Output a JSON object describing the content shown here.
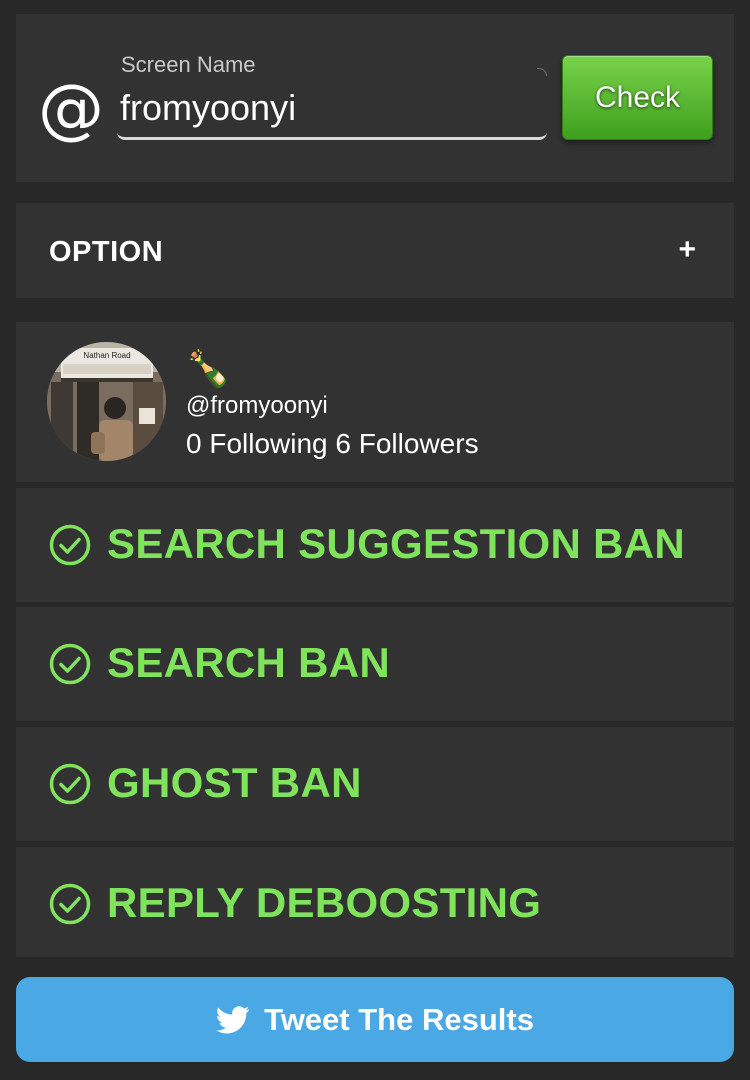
{
  "search": {
    "at_symbol": "@",
    "label": "Screen Name",
    "value": "fromyoonyi",
    "check_label": "Check"
  },
  "option": {
    "label": "OPTION",
    "toggle": "+"
  },
  "profile": {
    "emoji": "🍾",
    "handle": "@fromyoonyi",
    "follow_text": "0 Following 6 Followers",
    "avatar_sign_text": "Nathan Road"
  },
  "results": [
    {
      "label": "SEARCH SUGGESTION BAN",
      "status": "ok"
    },
    {
      "label": "SEARCH BAN",
      "status": "ok"
    },
    {
      "label": "GHOST BAN",
      "status": "ok"
    },
    {
      "label": "REPLY DEBOOSTING",
      "status": "ok"
    }
  ],
  "tweet": {
    "label": "Tweet The Results",
    "icon": "twitter-bird-icon"
  },
  "colors": {
    "background": "#282828",
    "card": "#323232",
    "ok_green": "#7fe35b",
    "check_button": "#4caf28",
    "tweet_blue": "#4aa8e4"
  }
}
